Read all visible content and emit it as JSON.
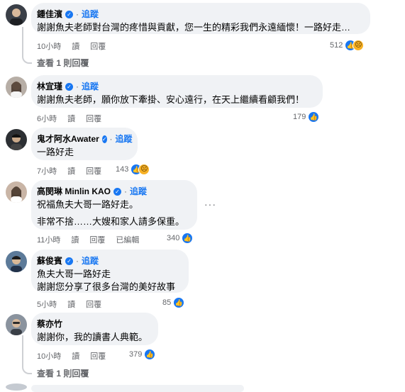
{
  "comments": [
    {
      "name": "鍾佳濱",
      "follow": "追蹤",
      "lines": [
        "謝謝魚夫老師對台灣的疼惜與貢獻，您一生的精彩我們永遠緬懷！一路好走…"
      ],
      "time": "10小時",
      "read": "讀",
      "reply": "回覆",
      "count": "512",
      "reactions": [
        "like",
        "sad"
      ],
      "replies_link": "查看 1 則回覆",
      "avatar_color": "#3a3f47"
    },
    {
      "name": "林宜瑾",
      "follow": "追蹤",
      "lines": [
        "謝謝魚夫老師，願你放下牽掛、安心遠行，在天上繼續看顧我們！"
      ],
      "time": "6小時",
      "read": "讀",
      "reply": "回覆",
      "count": "179",
      "reactions": [
        "like"
      ],
      "avatar_color": "#8a7f76"
    },
    {
      "name": "鬼才阿水Awater",
      "follow": "追蹤",
      "lines": [
        "一路好走"
      ],
      "time": "7小時",
      "read": "讀",
      "reply": "回覆",
      "count": "143",
      "reactions": [
        "like",
        "sad"
      ],
      "avatar_color": "#2c2f33"
    },
    {
      "name": "高閔琳 Minlin KAO",
      "follow": "追蹤",
      "lines": [
        "祝福魚夫大哥一路好走。",
        "非常不捨……大嫂和家人請多保重。"
      ],
      "time": "11小時",
      "read": "讀",
      "reply": "回覆",
      "edited": "已編輯",
      "count": "340",
      "reactions": [
        "like"
      ],
      "more_label": "···",
      "avatar_color": "#9a7d6e"
    },
    {
      "name": "蘇俊賓",
      "follow": "追蹤",
      "lines": [
        "魚夫大哥一路好走",
        "謝謝您分享了很多台灣的美好故事"
      ],
      "time": "5小時",
      "read": "讀",
      "reply": "回覆",
      "count": "85",
      "reactions": [
        "like"
      ],
      "avatar_color": "#4a6a8a"
    },
    {
      "name": "蔡亦竹",
      "follow": "",
      "lines": [
        "謝謝你，我的讀書人典範。"
      ],
      "time": "10小時",
      "read": "讀",
      "reply": "回覆",
      "count": "379",
      "reactions": [
        "like"
      ],
      "replies_link": "查看 1 則回覆",
      "avatar_color": "#7e8793"
    }
  ],
  "colors": {
    "accent": "#1877f2",
    "bubble": "#f0f2f5",
    "meta": "#65676b",
    "sad": "#f7b125"
  },
  "icons": {
    "like": "thumbs-up-icon",
    "sad": "sad-face-icon",
    "verified": "verified-badge-icon"
  }
}
